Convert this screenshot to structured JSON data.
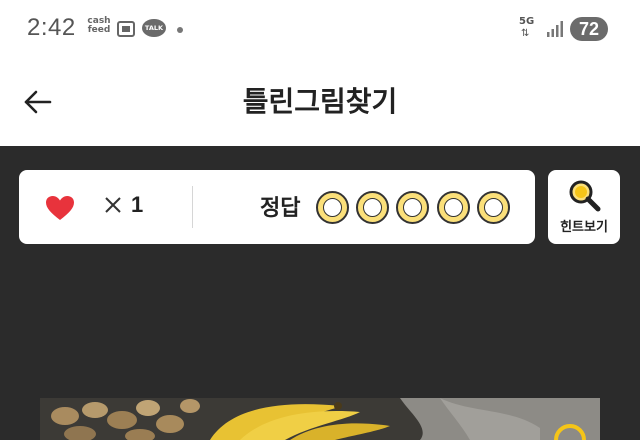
{
  "status_bar": {
    "time": "2:42",
    "notifications": [
      "cash-feed-icon",
      "image-icon",
      "kakaotalk-icon"
    ],
    "cash_feed_label_top": "cash",
    "cash_feed_label_bottom": "feed",
    "talk_label": "TALK",
    "network_label": "5G",
    "battery": "72"
  },
  "header": {
    "title": "틀린그림찾기",
    "back_icon": "arrow-left-icon"
  },
  "game_bar": {
    "lives_icon": "heart-icon",
    "lives_multiplier": "×",
    "lives_count": "1",
    "answer_label": "정답",
    "answer_slots_total": 5,
    "answer_slots_found": 0
  },
  "hint": {
    "label": "힌트보기",
    "icon": "magnifier-icon"
  },
  "colors": {
    "background": "#2b2b2b",
    "heart": "#e8333c",
    "slot_fill": "#fbe07a",
    "hint_icon": "#f5c518"
  }
}
